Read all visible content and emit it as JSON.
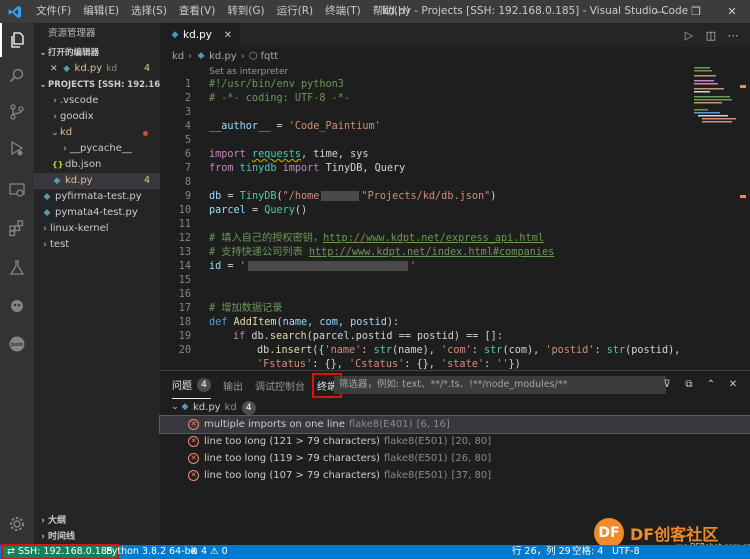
{
  "titlebar": {
    "menu": [
      "文件(F)",
      "编辑(E)",
      "选择(S)",
      "查看(V)",
      "转到(G)",
      "运行(R)",
      "终端(T)",
      "帮助(H)"
    ],
    "title": "kd.py - Projects [SSH: 192.168.0.185] - Visual Studio Code",
    "minimize": "—",
    "maximize": "❐",
    "close": "✕"
  },
  "sidebar": {
    "title": "资源管理器",
    "open_editors_label": "打开的编辑器",
    "open_editor": {
      "close": "✕",
      "name": "kd.py",
      "folder": "kd",
      "count": "4"
    },
    "project_label": "PROJECTS [SSH: 192.168.0....",
    "tree": [
      {
        "name": ".vscode",
        "type": "folder"
      },
      {
        "name": "goodix",
        "type": "folder"
      },
      {
        "name": "kd",
        "type": "folder-open"
      },
      {
        "name": "__pycache__",
        "type": "folder"
      },
      {
        "name": "db.json",
        "type": "json"
      },
      {
        "name": "kd.py",
        "type": "py",
        "count": "4"
      },
      {
        "name": "pyfirmata-test.py",
        "type": "py"
      },
      {
        "name": "pymata4-test.py",
        "type": "py"
      },
      {
        "name": "linux-kernel",
        "type": "folder"
      },
      {
        "name": "test",
        "type": "folder"
      }
    ],
    "outline_label": "大纲",
    "timeline_label": "时间线"
  },
  "tab": {
    "name": "kd.py",
    "close": "✕"
  },
  "breadcrumb": {
    "folder": "kd",
    "file": "kd.py",
    "symbol": "fqtt"
  },
  "editor": {
    "codelens": "Set as interpreter",
    "line_numbers": [
      "1",
      "2",
      "3",
      "4",
      "5",
      "6",
      "7",
      "8",
      "9",
      "10",
      "11",
      "12",
      "13",
      "14",
      "15",
      "16",
      "17",
      "18",
      "19",
      "20"
    ],
    "l1": "#!/usr/bin/env python3",
    "l2": "# -*- coding: UTF-8 -*-",
    "l4a": "__author__",
    "l4b": " = ",
    "l4c": "'Code_Paintium'",
    "l6a": "import",
    "l6b": "requests",
    "l6c": ", time, sys",
    "l7a": "from",
    "l7b": " tinydb ",
    "l7c": "import",
    "l7d": " TinyDB, Query",
    "l9a": "db",
    "l9b": " = ",
    "l9c": "TinyDB",
    "l9d": "(",
    "l9e": "\"/home",
    "l9f": "\"Projects/kd/db.json\"",
    "l9g": ")",
    "l10a": "parcel",
    "l10b": " = ",
    "l10c": "Query",
    "l10d": "()",
    "l12a": "# 填入自己的授权密钥，",
    "l12b": "http://www.kdpt.net/express_api.html",
    "l13a": "# 支持快递公司列表 ",
    "l13b": "http://www.kdpt.net/index.html#companies",
    "l14a": "id",
    "l14b": " = ",
    "l14c": "'",
    "l14d": "'",
    "l17": "# 增加数据记录",
    "l18a": "def",
    "l18b": " AddItem",
    "l18c": "(",
    "l18d": "name, com, postid",
    "l18e": "):",
    "l19a": "if",
    "l19b": " db.",
    "l19c": "search",
    "l19d": "(parcel.postid == postid) == []:",
    "l20a": "db.",
    "l20b": "insert",
    "l20c": "({",
    "l20d": "'name'",
    "l20e": ": ",
    "l20f": "str",
    "l20g": "(name), ",
    "l20h": "'com'",
    "l20i": ": ",
    "l20j": "str",
    "l20k": "(com), ",
    "l20l": "'postid'",
    "l20m": ": ",
    "l20n": "str",
    "l20o": "(postid),",
    "l21a": "'Fstatus'",
    "l21b": ": {}, ",
    "l21c": "'Cstatus'",
    "l21d": ": {}, ",
    "l21e": "'state'",
    "l21f": ": ",
    "l21g": "''",
    "l21h": "})"
  },
  "panel": {
    "tabs": [
      {
        "label": "问题",
        "badge": "4"
      },
      {
        "label": "输出"
      },
      {
        "label": "调试控制台"
      },
      {
        "label": "终端"
      }
    ],
    "filter_placeholder": "筛选器，例如: text、**/*.ts、!**/node_modules/**",
    "group": {
      "file": "kd.py",
      "folder": "kd",
      "count": "4"
    },
    "problems": [
      {
        "msg": "multiple imports on one line",
        "src": "flake8(E401)",
        "pos": "[6, 16]"
      },
      {
        "msg": "line too long (121 > 79 characters)",
        "src": "flake8(E501)",
        "pos": "[20, 80]"
      },
      {
        "msg": "line too long (119 > 79 characters)",
        "src": "flake8(E501)",
        "pos": "[26, 80]"
      },
      {
        "msg": "line too long (107 > 79 characters)",
        "src": "flake8(E501)",
        "pos": "[37, 80]"
      }
    ]
  },
  "status": {
    "remote": "SSH: 192.168.0.185",
    "python": "Python 3.8.2 64-bit",
    "errors": "4",
    "warnings": "0",
    "position": "行 26，列 29",
    "spaces": "空格: 4",
    "encoding": "UTF-8"
  },
  "watermark": {
    "logo": "DF",
    "text": "DF创客社区",
    "url": "mc.DFRobot.com.cn"
  },
  "colors": {
    "accent": "#007acc",
    "remote": "#16825d",
    "highlight_box": "#e01010"
  }
}
